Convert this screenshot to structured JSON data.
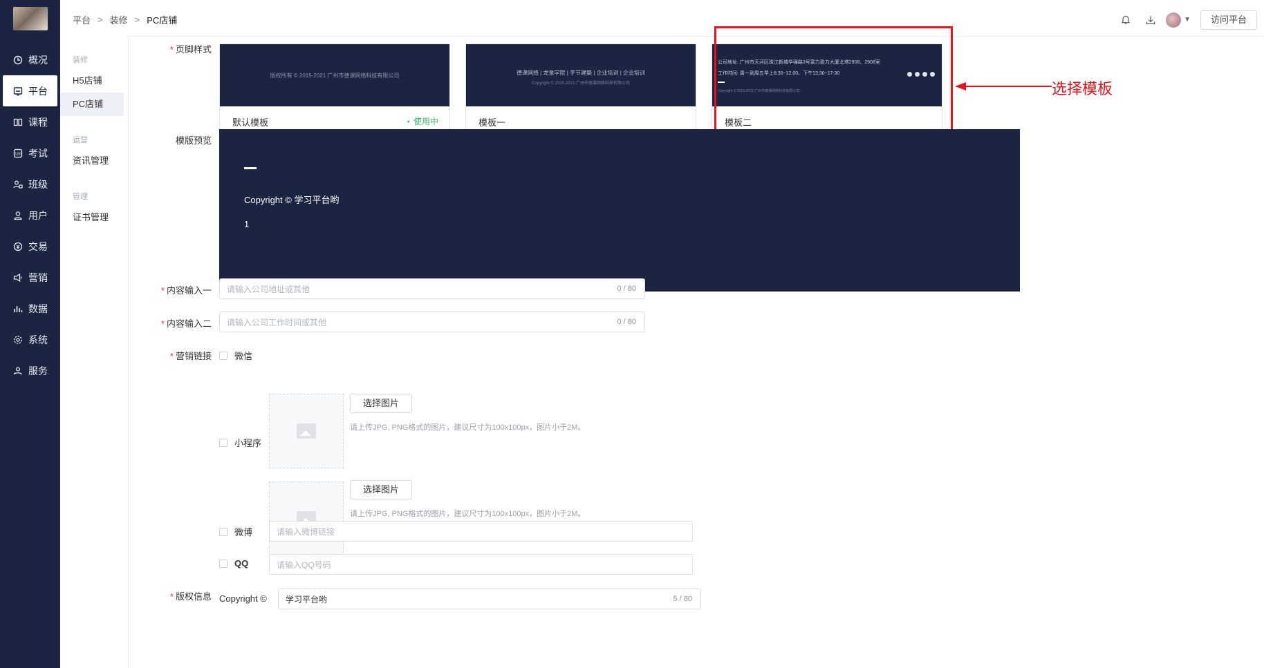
{
  "nav": {
    "items": [
      {
        "label": "概况",
        "icon": "dashboard-icon"
      },
      {
        "label": "平台",
        "icon": "platform-icon"
      },
      {
        "label": "课程",
        "icon": "book-icon"
      },
      {
        "label": "考试",
        "icon": "exam-icon"
      },
      {
        "label": "班级",
        "icon": "class-icon"
      },
      {
        "label": "用户",
        "icon": "user-icon"
      },
      {
        "label": "交易",
        "icon": "trade-icon"
      },
      {
        "label": "营销",
        "icon": "megaphone-icon"
      },
      {
        "label": "数据",
        "icon": "chart-icon"
      },
      {
        "label": "系统",
        "icon": "gear-icon"
      },
      {
        "label": "服务",
        "icon": "service-icon"
      }
    ],
    "active_index": 1
  },
  "sub": {
    "group1": "装修",
    "h5": "H5店铺",
    "pc": "PC店铺",
    "group2": "运营",
    "news": "资讯管理",
    "group3": "管理",
    "cert": "证书管理"
  },
  "header": {
    "crumb1": "平台",
    "crumb2": "装修",
    "crumb3": "PC店铺",
    "visit_label": "访问平台"
  },
  "form": {
    "footer_style_label": "页脚样式",
    "templates": [
      {
        "name": "默认模板",
        "status": "使用中",
        "thumb_text": "版权所有 © 2015-2021 广州市德课网络科技有限公司"
      },
      {
        "name": "模板一",
        "thumb_nav": "德课网络   |   龙泉学院   |   字节建築   |   企业培训   |   企业培训",
        "thumb_copy": "Copyright © 2015-2021 广州市德课网络科技有限公司"
      },
      {
        "name": "模板二",
        "thumb_addr": "公司地址:  广州市天河区珠江新城华强路3号富力盈力大厦北塔2908、2908室",
        "thumb_time": "工作时间:  周一到周五早上8:30~12:00、下午13:30~17:30",
        "thumb_copy": "Copyright © 2015-2021 广州市德课网络科技有限公司"
      }
    ],
    "annotation": "选择模板",
    "preview_label": "模版预览",
    "preview_copyright": "Copyright ©  学习平台哟",
    "preview_number": "1",
    "content1_label": "内容输入一",
    "content1_placeholder": "请输入公司地址或其他",
    "content1_count": "0 / 80",
    "content2_label": "内容输入二",
    "content2_placeholder": "请输入公司工作时间或其他",
    "content2_count": "0 / 80",
    "marketing_label": "营销链接",
    "wechat_label": "微信",
    "miniapp_label": "小程序",
    "pick_image": "选择图片",
    "image_hint": "请上传JPG, PNG格式的图片，建议尺寸为100x100px，图片小于2M。",
    "weibo_label": "微博",
    "weibo_placeholder": "请输入微博链接",
    "qq_label": "QQ",
    "qq_placeholder": "请输入QQ号码",
    "copyright_label": "版权信息",
    "copyright_prefix": "Copyright ©",
    "copyright_value": "学习平台哟",
    "copyright_count": "5 / 80"
  },
  "colors": {
    "nav_bg": "#1b2541",
    "accent_red": "#e8141c",
    "status_green": "#3bbd64"
  }
}
